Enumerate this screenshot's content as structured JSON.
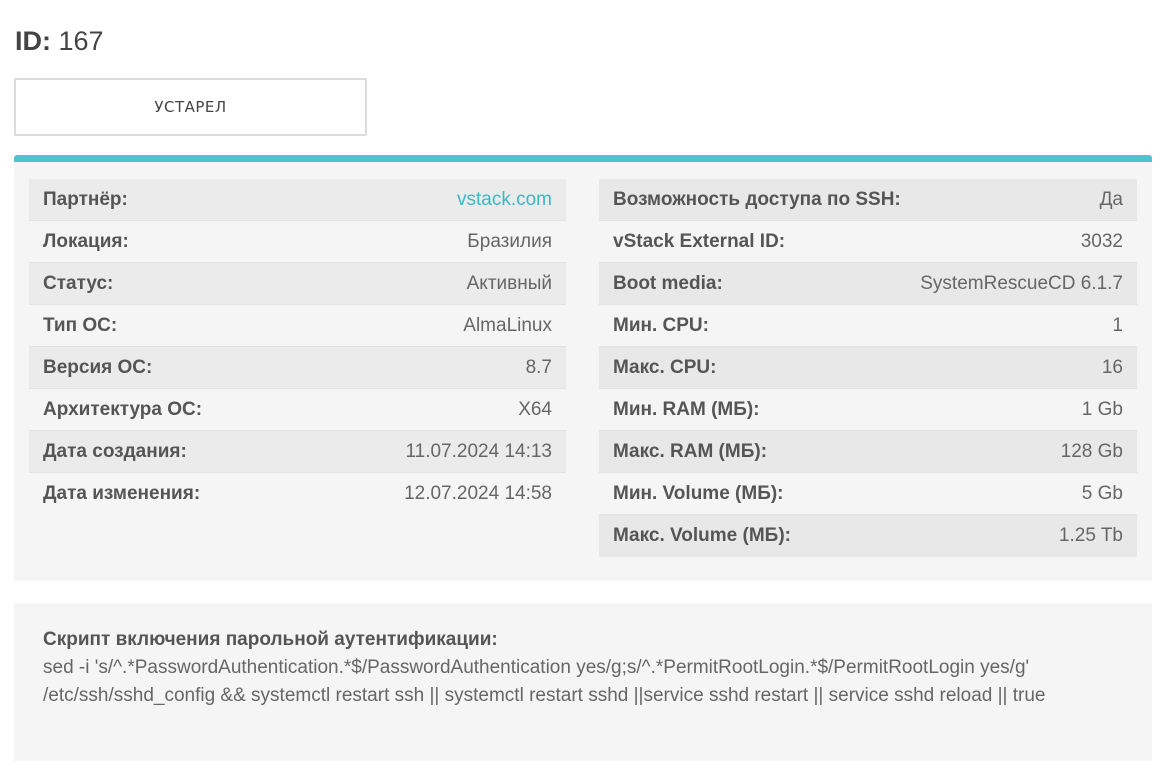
{
  "header": {
    "id_label": "ID:",
    "id_value": "167"
  },
  "status_box": {
    "label": "УСТАРЕЛ"
  },
  "colors": {
    "accent": "#4fc4cf",
    "link": "#3cb7c4",
    "panel_bg": "#f5f5f5"
  },
  "left_fields": [
    {
      "label": "Партнёр:",
      "value": "vstack.com"
    },
    {
      "label": "Локация:",
      "value": "Бразилия"
    },
    {
      "label": "Статус:",
      "value": "Активный"
    },
    {
      "label": "Тип ОС:",
      "value": "AlmaLinux"
    },
    {
      "label": "Версия ОС:",
      "value": "8.7"
    },
    {
      "label": "Архитектура ОС:",
      "value": "X64"
    },
    {
      "label": "Дата создания:",
      "value": "11.07.2024 14:13"
    },
    {
      "label": "Дата изменения:",
      "value": "12.07.2024 14:58"
    }
  ],
  "right_fields": [
    {
      "label": "Возможность доступа по SSH:",
      "value": "Да"
    },
    {
      "label": "vStack External ID:",
      "value": "3032"
    },
    {
      "label": "Boot media:",
      "value": "SystemRescueCD 6.1.7"
    },
    {
      "label": "Мин. CPU:",
      "value": "1"
    },
    {
      "label": "Макс. CPU:",
      "value": "16"
    },
    {
      "label": "Мин. RAM (МБ):",
      "value": "1 Gb"
    },
    {
      "label": "Макс. RAM (МБ):",
      "value": "128 Gb"
    },
    {
      "label": "Мин. Volume (МБ):",
      "value": "5 Gb"
    },
    {
      "label": "Макс. Volume (МБ):",
      "value": "1.25 Tb"
    }
  ],
  "script": {
    "label": "Скрипт включения парольной аутентификации:",
    "text": "sed -i 's/^.*PasswordAuthentication.*$/PasswordAuthentication yes/g;s/^.*PermitRootLogin.*$/PermitRootLogin yes/g' /etc/ssh/sshd_config && systemctl restart ssh || systemctl restart sshd ||service sshd restart || service sshd reload || true"
  }
}
